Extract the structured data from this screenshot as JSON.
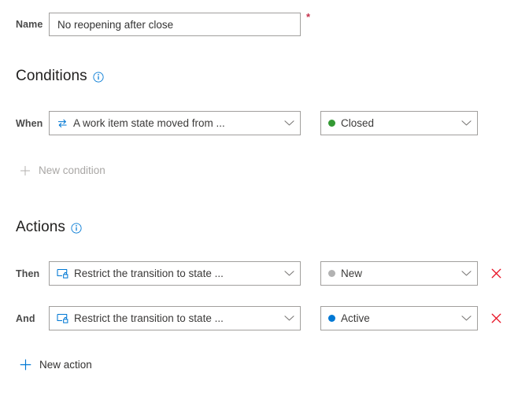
{
  "colors": {
    "accent_blue": "#0078d4",
    "border_grey": "#a19f9d",
    "required_red": "#c4314b",
    "delete_red": "#e81123",
    "disabled_grey": "#a9a7a5",
    "text_dark": "#323130",
    "state_closed": "#339933",
    "state_new": "#b2b2b2",
    "state_active": "#0078d4"
  },
  "name_field": {
    "label": "Name",
    "value": "No reopening after close",
    "placeholder": "",
    "required_marker": "*"
  },
  "conditions": {
    "heading": "Conditions",
    "info_icon": "info-icon",
    "rows": [
      {
        "label": "When",
        "rule": {
          "icon": "transition-arrows-icon",
          "text": "A work item state moved from ...",
          "chevron": "chevron-down-icon"
        },
        "value": {
          "dot_color": "#339933",
          "text": "Closed",
          "chevron": "chevron-down-icon"
        }
      }
    ],
    "add_link": {
      "icon": "plus-icon",
      "label": "New condition",
      "enabled": false
    }
  },
  "actions": {
    "heading": "Actions",
    "info_icon": "info-icon",
    "rows": [
      {
        "label": "Then",
        "rule": {
          "icon": "restrict-lock-icon",
          "text": "Restrict the transition to state ...",
          "chevron": "chevron-down-icon"
        },
        "value": {
          "dot_color": "#b2b2b2",
          "text": "New",
          "chevron": "chevron-down-icon"
        },
        "delete_icon": "close-icon"
      },
      {
        "label": "And",
        "rule": {
          "icon": "restrict-lock-icon",
          "text": "Restrict the transition to state ...",
          "chevron": "chevron-down-icon"
        },
        "value": {
          "dot_color": "#0078d4",
          "text": "Active",
          "chevron": "chevron-down-icon"
        },
        "delete_icon": "close-icon"
      }
    ],
    "add_link": {
      "icon": "plus-icon",
      "label": "New action",
      "enabled": true
    }
  }
}
